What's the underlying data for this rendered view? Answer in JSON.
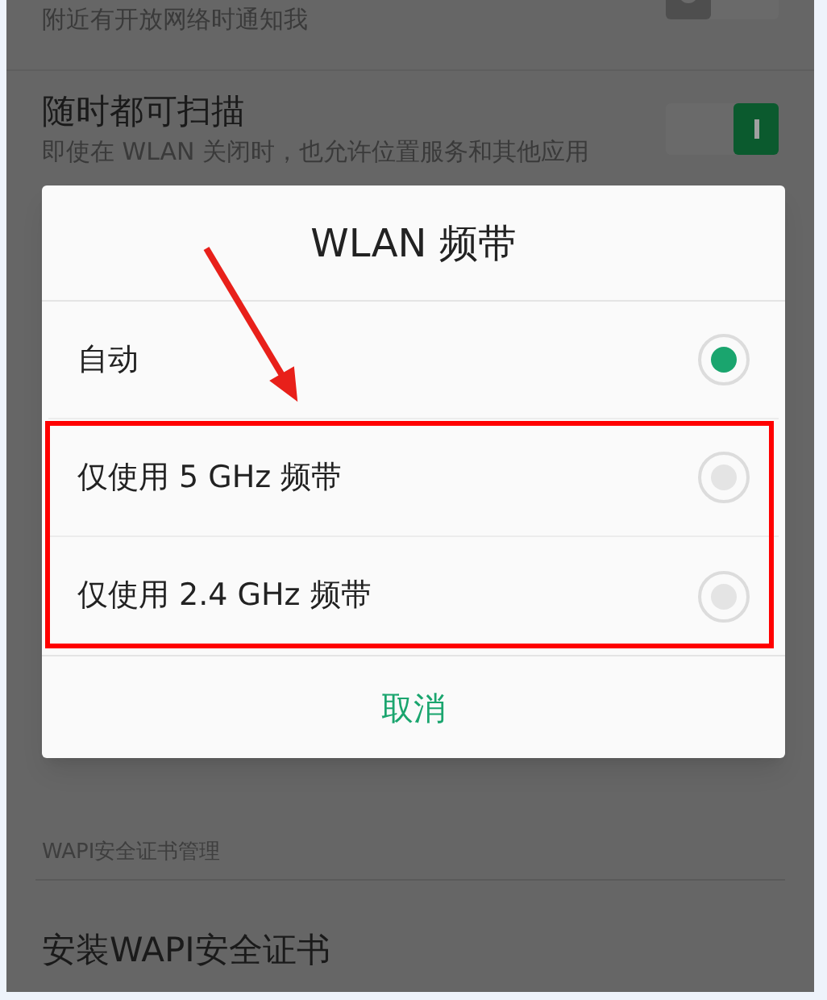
{
  "settings": [
    {
      "kind": "toggle_row",
      "subtitle": "附近有开放网络时通知我",
      "on": false
    },
    {
      "kind": "toggle_row",
      "title": "随时都可扫描",
      "subtitle": "即使在 WLAN 关闭时，也允许位置服务和其他应用",
      "on": true
    }
  ],
  "section": {
    "header": "WAPI安全证书管理",
    "items": [
      "安装WAPI安全证书"
    ]
  },
  "dialog": {
    "title": "WLAN 频带",
    "options": [
      {
        "label": "自动",
        "selected": true
      },
      {
        "label": "仅使用 5 GHz 频带",
        "selected": false
      },
      {
        "label": "仅使用 2.4 GHz 频带",
        "selected": false
      }
    ],
    "cancel": "取消"
  }
}
